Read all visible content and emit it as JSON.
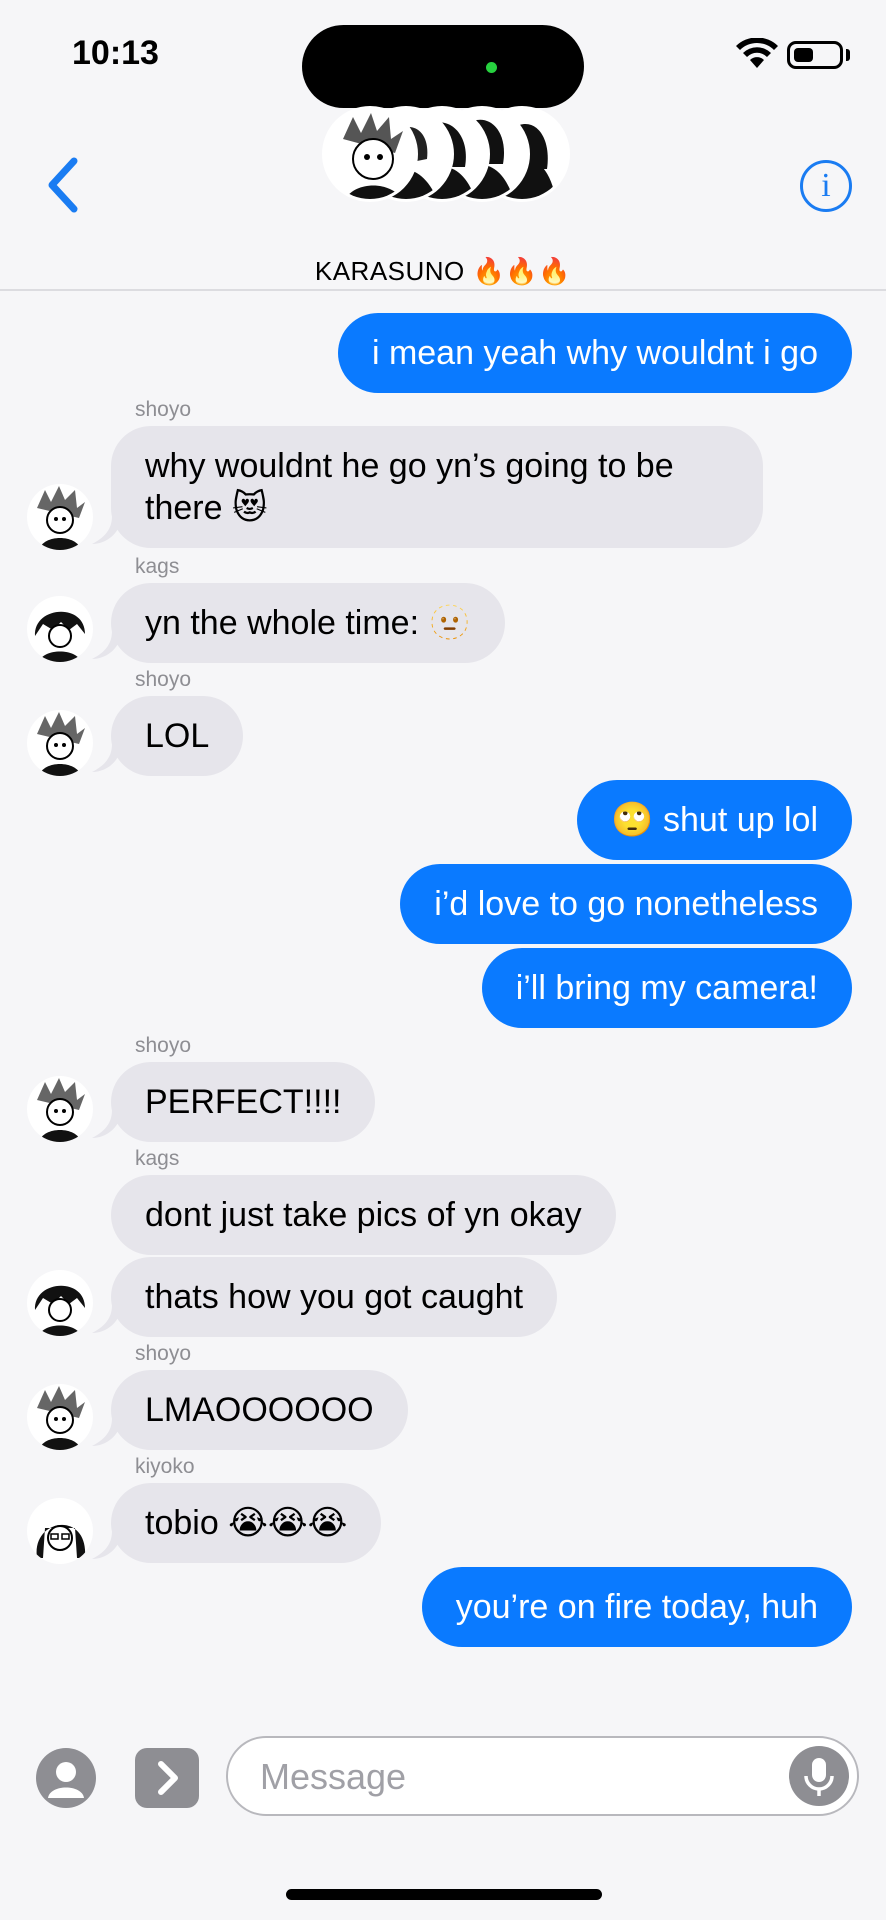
{
  "status_bar": {
    "time": "10:13",
    "battery_level": 0.45
  },
  "header": {
    "group_name": "KARASUNO 🔥🔥🔥"
  },
  "messages": [
    {
      "from": "me",
      "text": "i mean yeah why wouldnt i go"
    },
    {
      "from": "shoyo",
      "sender_label": "shoyo",
      "text_line1": "why wouldnt he go yn’s going to be",
      "text_line2": "there 😻"
    },
    {
      "from": "kags",
      "sender_label": "kags",
      "text": "yn the whole time: 🫥"
    },
    {
      "from": "shoyo",
      "sender_label": "shoyo",
      "text": "LOL"
    },
    {
      "from": "me",
      "text": "🙄 shut up lol"
    },
    {
      "from": "me",
      "text": "i’d love to go nonetheless"
    },
    {
      "from": "me",
      "text": "i’ll bring my camera!"
    },
    {
      "from": "shoyo",
      "sender_label": "shoyo",
      "text": "PERFECT!!!!"
    },
    {
      "from": "kags",
      "sender_label": "kags",
      "text": "dont just take pics of yn okay"
    },
    {
      "from": "kags",
      "text": "thats how you got caught"
    },
    {
      "from": "shoyo",
      "sender_label": "shoyo",
      "text": "LMAOOOOOO"
    },
    {
      "from": "kiyoko",
      "sender_label": "kiyoko",
      "text": "tobio 😭😭😭"
    },
    {
      "from": "me",
      "text": "you’re on fire today, huh"
    }
  ],
  "input": {
    "placeholder": "Message"
  },
  "colors": {
    "accent": "#0a7aff",
    "incoming_bubble": "#e6e5eb",
    "background": "#f6f6f8"
  },
  "icons": [
    "back-chevron-icon",
    "info-icon",
    "wifi-icon",
    "battery-icon",
    "apps-icon",
    "app-store-icon",
    "microphone-icon"
  ]
}
